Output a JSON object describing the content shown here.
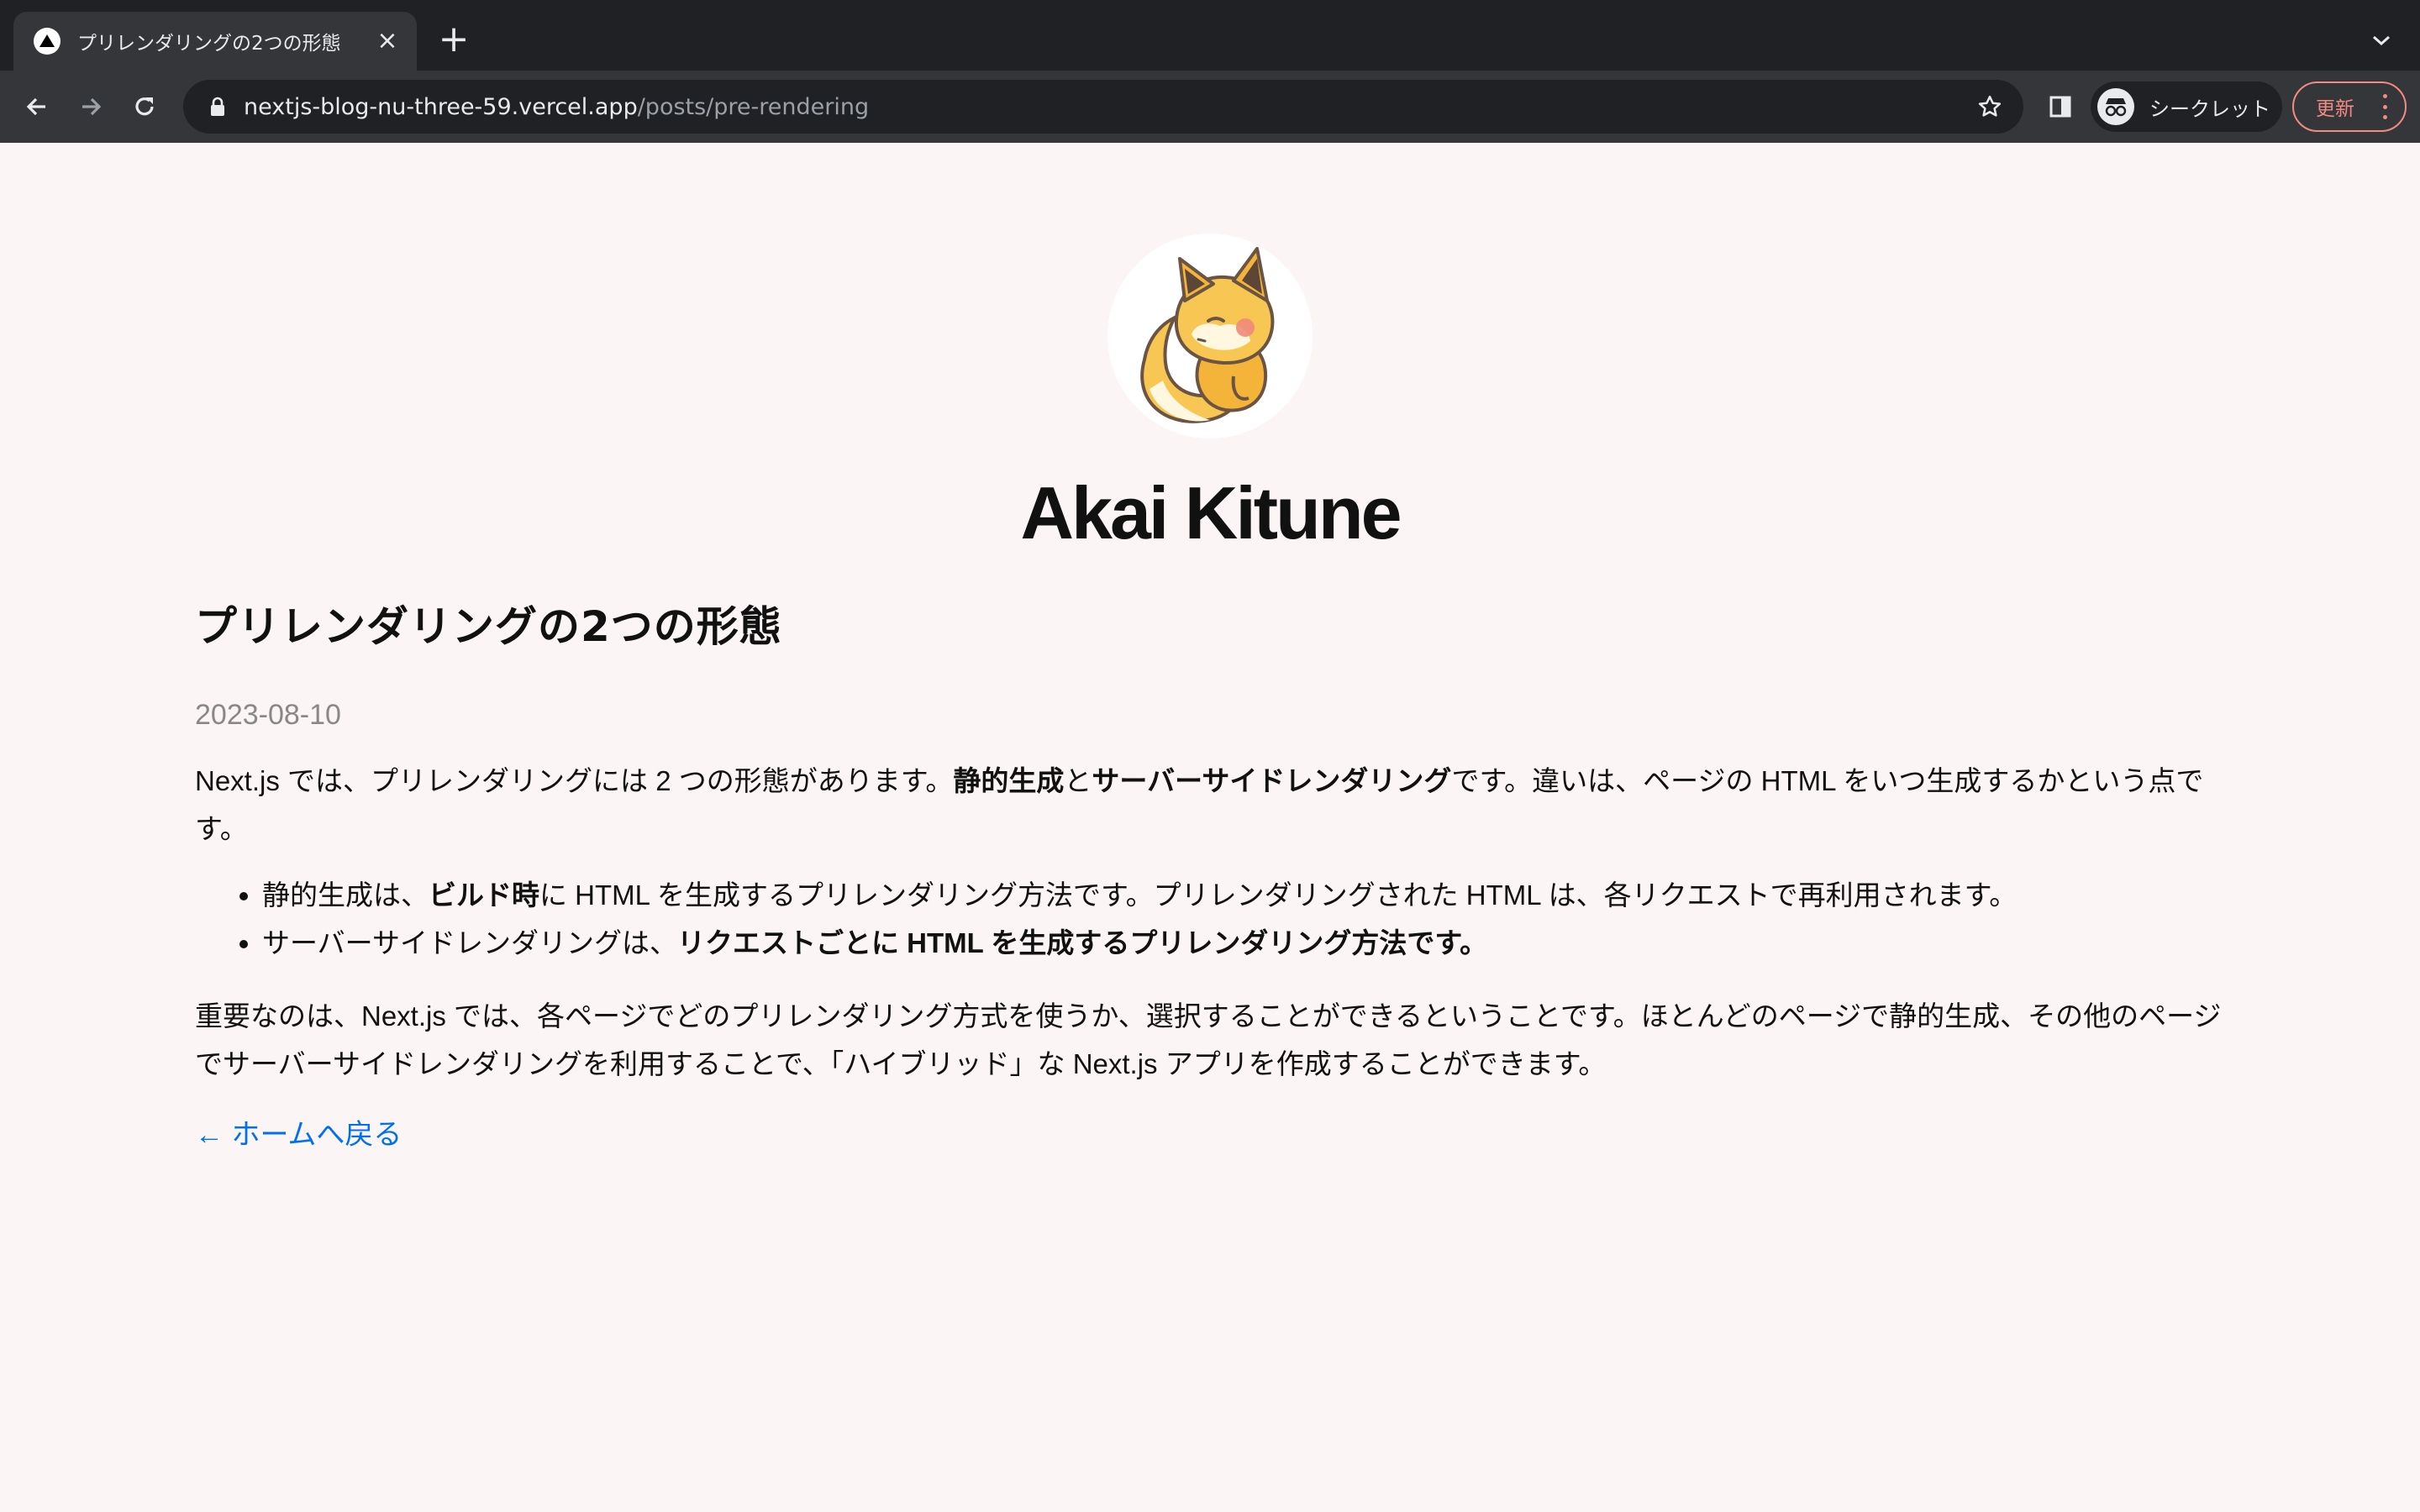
{
  "browser": {
    "tab": {
      "title": "プリレンダリングの2つの形態",
      "close_glyph": "×"
    },
    "new_tab_glyph": "+",
    "address": {
      "host": "nextjs-blog-nu-three-59.vercel.app",
      "path": "/posts/pre-rendering"
    },
    "incognito_label": "シークレット",
    "update_label": "更新",
    "colors": {
      "tabstrip": "#202124",
      "toolbar": "#35363a",
      "update_accent": "#f28b82"
    },
    "icons": [
      "back-arrow-icon",
      "forward-arrow-icon",
      "reload-icon",
      "lock-icon",
      "bookmark-star-icon",
      "side-panel-icon",
      "incognito-icon",
      "kebab-menu-icon",
      "tab-search-chevron-icon"
    ]
  },
  "site": {
    "name": "Akai Kitune",
    "avatar_icon": "fox-avatar-icon"
  },
  "post": {
    "title": "プリレンダリングの2つの形態",
    "date": "2023-08-10",
    "intro": {
      "before": "Next.js では、プリレンダリングには 2 つの形態があります。",
      "bold1": "静的生成",
      "mid": "と",
      "bold2": "サーバーサイドレンダリング",
      "after": "です。違いは、ページの HTML をいつ生成するかという点です。"
    },
    "bullets": [
      {
        "before": "静的生成は、",
        "bold": "ビルド時",
        "after": "に HTML を生成するプリレンダリング方法です。プリレンダリングされた HTML は、各リクエストで再利用されます。"
      },
      {
        "before": "サーバーサイドレンダリングは、",
        "bold": "リクエストごとに HTML を生成するプリレンダリング方法です。",
        "after": ""
      }
    ],
    "closing": "重要なのは、Next.js では、各ページでどのプリレンダリング方式を使うか、選択することができるということです。ほとんどのページで静的生成、その他のページでサーバーサイドレンダリングを利用することで、「ハイブリッド」な Next.js アプリを作成することができます。",
    "back_link": "← ホームへ戻る",
    "link_color": "#0070f3"
  }
}
